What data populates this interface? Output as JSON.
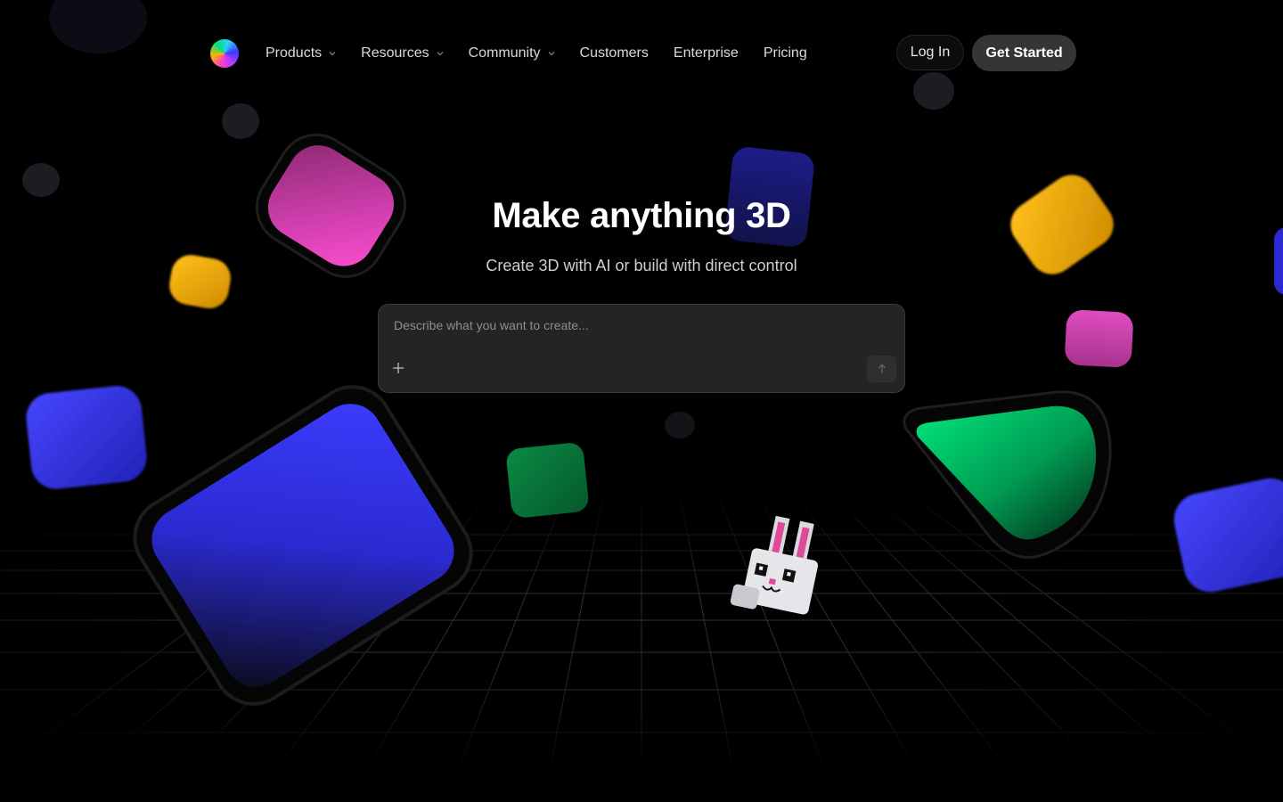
{
  "nav": {
    "logo_icon": "rainbow-orb-logo-icon",
    "items": [
      {
        "label": "Products",
        "has_dropdown": true
      },
      {
        "label": "Resources",
        "has_dropdown": true
      },
      {
        "label": "Community",
        "has_dropdown": true
      },
      {
        "label": "Customers",
        "has_dropdown": false
      },
      {
        "label": "Enterprise",
        "has_dropdown": false
      },
      {
        "label": "Pricing",
        "has_dropdown": false
      }
    ],
    "login_label": "Log In",
    "cta_label": "Get Started"
  },
  "hero": {
    "title": "Make anything 3D",
    "subtitle": "Create 3D with AI or build with direct control"
  },
  "prompt": {
    "placeholder": "Describe what you want to create...",
    "value": "",
    "add_icon": "plus-icon",
    "send_icon": "arrow-up-icon"
  },
  "colors": {
    "background": "#000000",
    "pink": "#ff3ec8",
    "yellow": "#ffb400",
    "green": "#00e27a",
    "blue": "#3b3bff",
    "button_dark": "#353535",
    "input_bg": "#242424"
  }
}
